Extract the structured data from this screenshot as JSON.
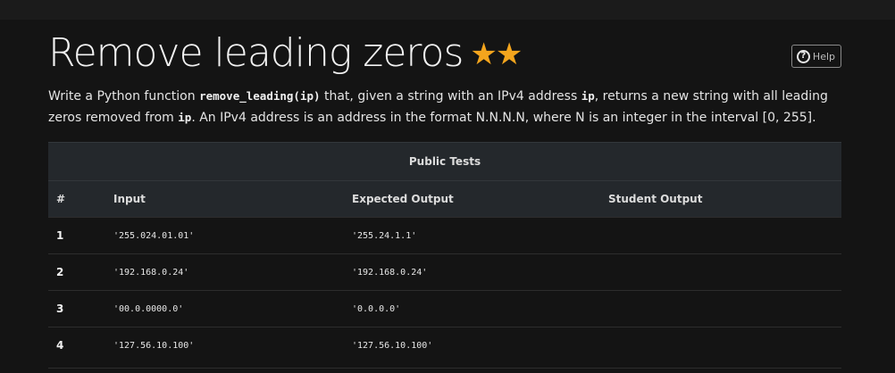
{
  "title": "Remove leading zeros",
  "stars": "★★",
  "help_label": "Help",
  "help_glyph": "?",
  "description": {
    "p1": "Write a Python function ",
    "fn": "remove_leading(ip)",
    "p2": " that, given a string with an IPv4 address ",
    "arg1": "ip",
    "p3": ", returns a new string with all leading zeros removed from ",
    "arg2": "ip",
    "p4": ". An IPv4 address is an address in the format N.N.N.N, where N is an integer in the interval [0, 255]."
  },
  "table": {
    "caption": "Public Tests",
    "headers": [
      "#",
      "Input",
      "Expected Output",
      "Student Output"
    ],
    "rows": [
      {
        "num": "1",
        "input": "'255.024.01.01'",
        "expected": "'255.24.1.1'",
        "student": ""
      },
      {
        "num": "2",
        "input": "'192.168.0.24'",
        "expected": "'192.168.0.24'",
        "student": ""
      },
      {
        "num": "3",
        "input": "'00.0.0000.0'",
        "expected": "'0.0.0.0'",
        "student": ""
      },
      {
        "num": "4",
        "input": "'127.56.10.100'",
        "expected": "'127.56.10.100'",
        "student": ""
      }
    ]
  },
  "colors": {
    "background": "#141414",
    "star": "#f4a51d",
    "table_header": "#24282c"
  }
}
